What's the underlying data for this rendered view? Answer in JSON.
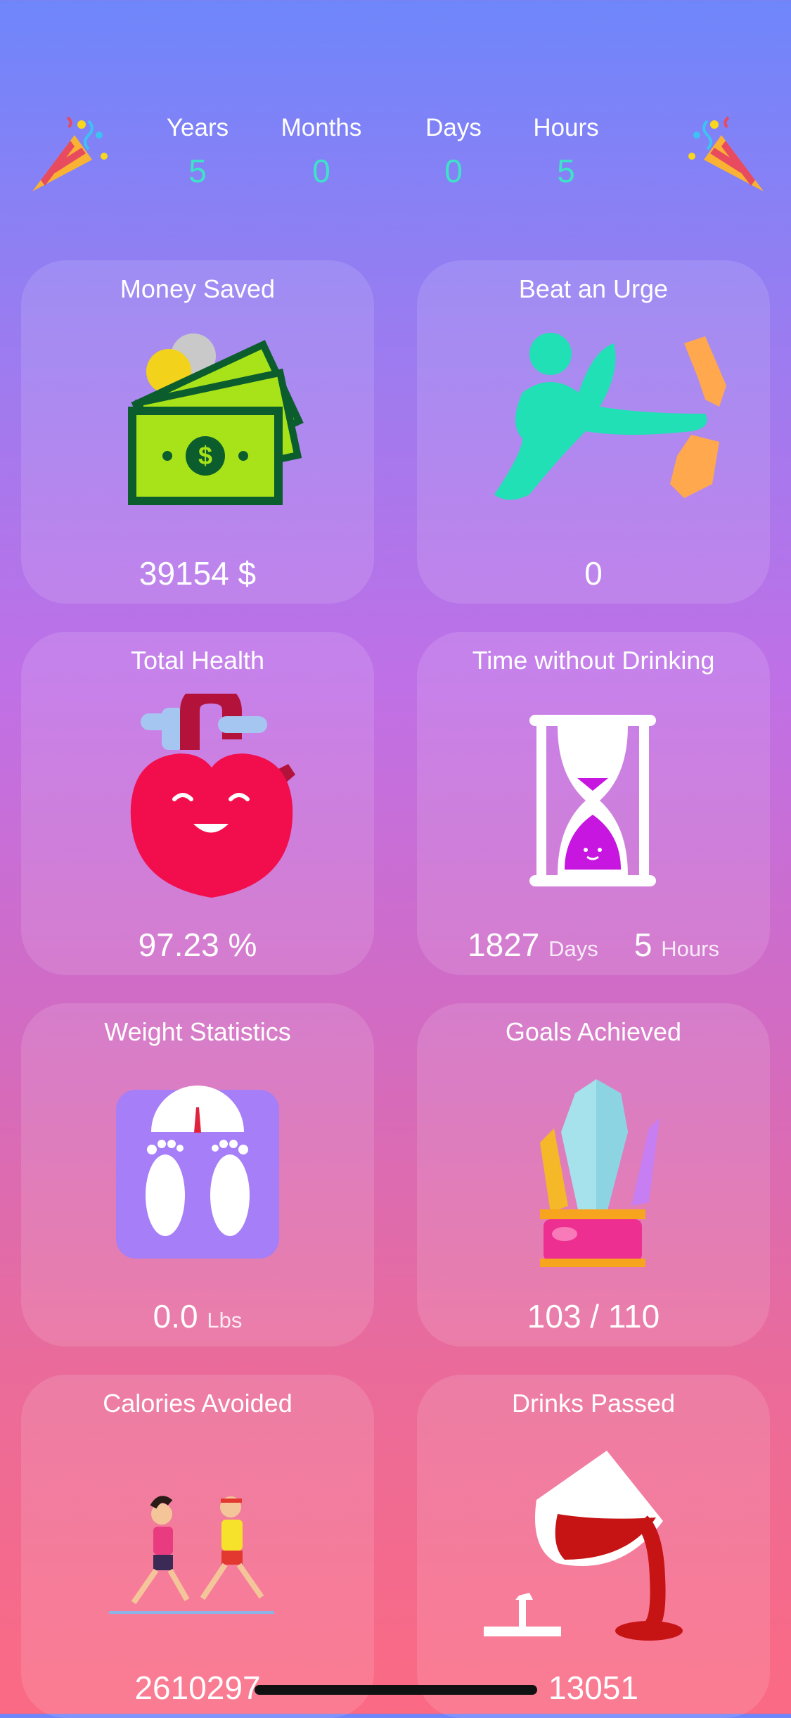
{
  "header": {
    "counters": [
      {
        "label": "Years",
        "value": "5"
      },
      {
        "label": "Months",
        "value": "0"
      },
      {
        "label": "Days",
        "value": "0"
      },
      {
        "label": "Hours",
        "value": "5"
      }
    ]
  },
  "cards": {
    "money_saved": {
      "title": "Money Saved",
      "value": "39154 $"
    },
    "beat_urge": {
      "title": "Beat an Urge",
      "value": "0"
    },
    "total_health": {
      "title": "Total Health",
      "value": "97.23 %"
    },
    "time_without": {
      "title": "Time without Drinking",
      "days_value": "1827",
      "days_unit": "Days",
      "hours_value": "5",
      "hours_unit": "Hours"
    },
    "weight": {
      "title": "Weight Statistics",
      "value": "0.0",
      "unit": "Lbs"
    },
    "goals": {
      "title": "Goals Achieved",
      "value": "103 / 110"
    },
    "calories": {
      "title": "Calories Avoided",
      "value": "2610297"
    },
    "drinks": {
      "title": "Drinks Passed",
      "value": "13051"
    }
  },
  "colors": {
    "accent_counter": "#3ee2c8",
    "card_bg": "rgba(255,255,255,0.12)"
  },
  "icons": [
    "party-popper-icon",
    "money-stack-icon",
    "kick-bottle-icon",
    "happy-heart-icon",
    "hourglass-icon",
    "scale-feet-icon",
    "crystal-trophy-icon",
    "runners-icon",
    "spilled-wine-icon"
  ]
}
